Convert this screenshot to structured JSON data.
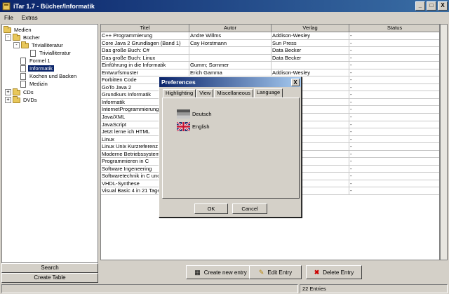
{
  "window": {
    "title": "iTar 1.7 - Bücher/Informatik",
    "minimize": "_",
    "maximize": "□",
    "close": "X"
  },
  "menu": {
    "file": "File",
    "extras": "Extras"
  },
  "tree": {
    "root": "Medien",
    "buecher": "Bücher",
    "trivialliteratur_folder": "Trivialliteratur",
    "trivialliteratur_item": "Trivialliteratur",
    "formel1": "Formel 1",
    "informatik": "Informatik",
    "kochen": "Kochen und Backen",
    "medizin": "Medizin",
    "cds": "CDs",
    "dvds": "DVDs",
    "collapse": "-",
    "expand": "+"
  },
  "sidebar": {
    "search": "Search",
    "create_table": "Create Table"
  },
  "table": {
    "headers": [
      "Titel",
      "Autor",
      "Verlag",
      "Status"
    ],
    "rows": [
      [
        "C++ Programmierung",
        "Andre Willms",
        "Addison-Wesley",
        "-"
      ],
      [
        "Core Java 2 Grundlagen (Band 1)",
        "Cay Horstmann",
        "Sun Press",
        "-"
      ],
      [
        "Das große Buch: C#",
        "",
        "Data Becker",
        "-"
      ],
      [
        "Das große Buch: Linux",
        "",
        "Data Becker",
        "-"
      ],
      [
        "Einführung in die Informatik",
        "Gumm; Sommer",
        "",
        "-"
      ],
      [
        "Entwurfsmuster",
        "Erich Gamma",
        "Addison-Wesley",
        "-"
      ],
      [
        "Forbitten Code",
        "",
        "",
        "-"
      ],
      [
        "GoTo Java 2",
        "",
        "ley",
        "-"
      ],
      [
        "Grundkurs Informatik",
        "",
        "",
        "-"
      ],
      [
        "Informatik",
        "",
        "",
        "-"
      ],
      [
        "InternetProgrammierung m",
        "",
        "",
        "-"
      ],
      [
        "Java/XML",
        "",
        "",
        "-"
      ],
      [
        "JavaScript",
        "",
        "",
        "-"
      ],
      [
        "Jetzt lerne ich HTML",
        "",
        "chnik",
        "-"
      ],
      [
        "Linux",
        "",
        "ley",
        "-"
      ],
      [
        "Linux Unix Kurzreferenz",
        "",
        "ley",
        "-"
      ],
      [
        "Moderne Betriebssysteme",
        "",
        "um",
        "-"
      ],
      [
        "Programmieren in C",
        "",
        "",
        "-"
      ],
      [
        "Software Ingeneering",
        "",
        "um",
        "-"
      ],
      [
        "Softwaretechnik in C und",
        "",
        "",
        "-"
      ],
      [
        "VHDL-Synthese",
        "",
        "",
        "-"
      ],
      [
        "Visual Basic 4 in 21 Tagen",
        "",
        "",
        "-"
      ]
    ]
  },
  "actions": {
    "create": "Create new entry",
    "edit": "Edit Entry",
    "delete": "Delete Entry"
  },
  "status": {
    "entries": "22 Entries"
  },
  "dialog": {
    "title": "Preferences",
    "close": "X",
    "tabs": [
      "Highlighting",
      "View",
      "Miscellaneous",
      "Language"
    ],
    "active_tab": "Language",
    "languages": [
      "Deutsch",
      "English"
    ],
    "ok": "OK",
    "cancel": "Cancel"
  },
  "colors": {
    "titlebar": "#0a246a",
    "selection": "#0a246a",
    "face": "#d4d0c8"
  }
}
